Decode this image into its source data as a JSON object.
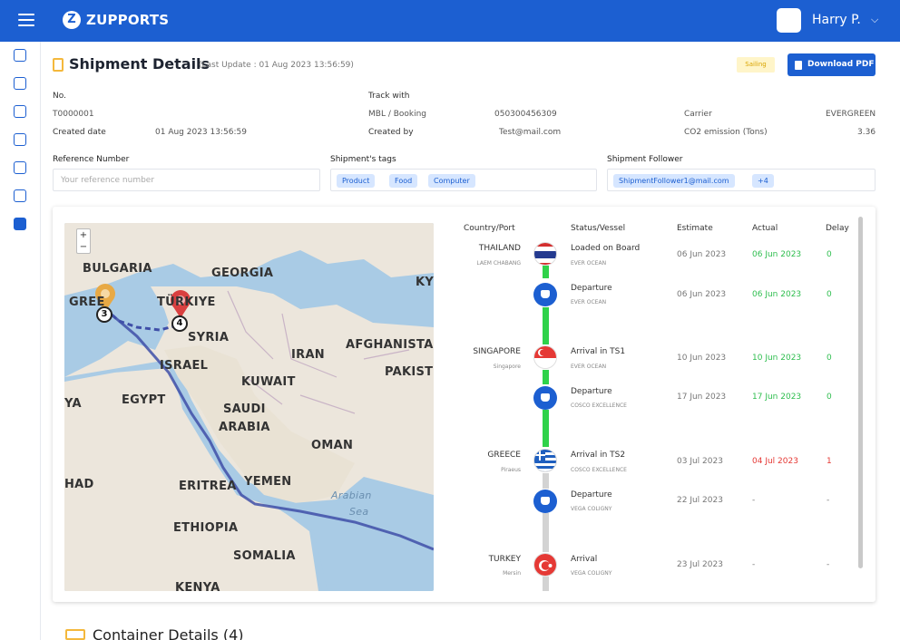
{
  "app": {
    "brand_letter": "Z",
    "brand": "ZUPPORTS",
    "user_name": "Harry P.",
    "caret": "⌵"
  },
  "header": {
    "title": "Shipment Details",
    "last_update": "(Last Update : 01 Aug 2023 13:56:59)",
    "status": "Sailing",
    "download_label": "Download PDF"
  },
  "info": {
    "no_label": "No.",
    "no_value": "T0000001",
    "created_date_label": "Created date",
    "created_date_value": "01 Aug 2023 13:56:59",
    "track_with_label": "Track with",
    "mbl_label": "MBL / Booking",
    "mbl_value": "050300456309",
    "created_by_label": "Created by",
    "created_by_value": "Test@mail.com",
    "carrier_label": "Carrier",
    "carrier_value": "EVERGREEN",
    "co2_label": "CO2 emission (Tons)",
    "co2_value": "3.36"
  },
  "fields": {
    "reference_label": "Reference Number",
    "reference_placeholder": "Your reference number",
    "tags_label": "Shipment's tags",
    "tags": [
      "Product",
      "Food",
      "Computer"
    ],
    "follower_label": "Shipment Follower",
    "follower_email": "ShipmentFollower1@mail.com",
    "follower_more": "+4"
  },
  "map": {
    "zoom_in": "+",
    "zoom_out": "−",
    "labels": [
      "BULGARIA",
      "GEORGIA",
      "GREE",
      "TÜRKIYE",
      "SYRIA",
      "IRAN",
      "AFGHANISTAN",
      "ISRAEL",
      "PAKIST",
      "KUWAIT",
      "EGYPT",
      "SAUDI",
      "ARABIA",
      "YA",
      "OMAN",
      "YEMEN",
      "ERITREA",
      "Arabian",
      "Sea",
      "HAD",
      "ETHIOPIA",
      "SOMALIA",
      "KENYA",
      "KY"
    ],
    "markers": [
      "3",
      "4"
    ],
    "route_color": "#3f4fa8"
  },
  "timeline": {
    "headers": [
      "Country/Port",
      "Status/Vessel",
      "Estimate",
      "Actual",
      "Delay"
    ],
    "rows": [
      {
        "country": "THAILAND",
        "port": "LAEM CHABANG",
        "status": "Loaded on Board",
        "vessel": "EVER OCEAN",
        "estimate": "06 Jun 2023",
        "actual": "06 Jun 2023",
        "delay": "0",
        "node": "flag-thailand"
      },
      {
        "country": "",
        "port": "",
        "status": "Departure",
        "vessel": "EVER OCEAN",
        "estimate": "06 Jun 2023",
        "actual": "06 Jun 2023",
        "delay": "0",
        "node": "ship"
      },
      {
        "country": "SINGAPORE",
        "port": "Singapore",
        "status": "Arrival in TS1",
        "vessel": "EVER OCEAN",
        "estimate": "10 Jun 2023",
        "actual": "10 Jun 2023",
        "delay": "0",
        "node": "flag-singapore"
      },
      {
        "country": "",
        "port": "",
        "status": "Departure",
        "vessel": "COSCO EXCELLENCE",
        "estimate": "17 Jun 2023",
        "actual": "17 Jun 2023",
        "delay": "0",
        "node": "ship"
      },
      {
        "country": "GREECE",
        "port": "Piraeus",
        "status": "Arrival in TS2",
        "vessel": "COSCO EXCELLENCE",
        "estimate": "03 Jul 2023",
        "actual": "04 Jul 2023",
        "delay": "1",
        "node": "flag-greece"
      },
      {
        "country": "",
        "port": "",
        "status": "Departure",
        "vessel": "VEGA COLIGNY",
        "estimate": "22 Jul 2023",
        "actual": "-",
        "delay": "-",
        "node": "ship"
      },
      {
        "country": "TURKEY",
        "port": "Mersin",
        "status": "Arrival",
        "vessel": "VEGA COLIGNY",
        "estimate": "23 Jul 2023",
        "actual": "-",
        "delay": "-",
        "node": "flag-turkey"
      }
    ]
  },
  "container": {
    "title": "Container Details (4)"
  },
  "colors": {
    "primary": "#1c5fd1",
    "ok": "#2fbe4f",
    "late": "#e53935",
    "accent": "#f4b83c"
  }
}
